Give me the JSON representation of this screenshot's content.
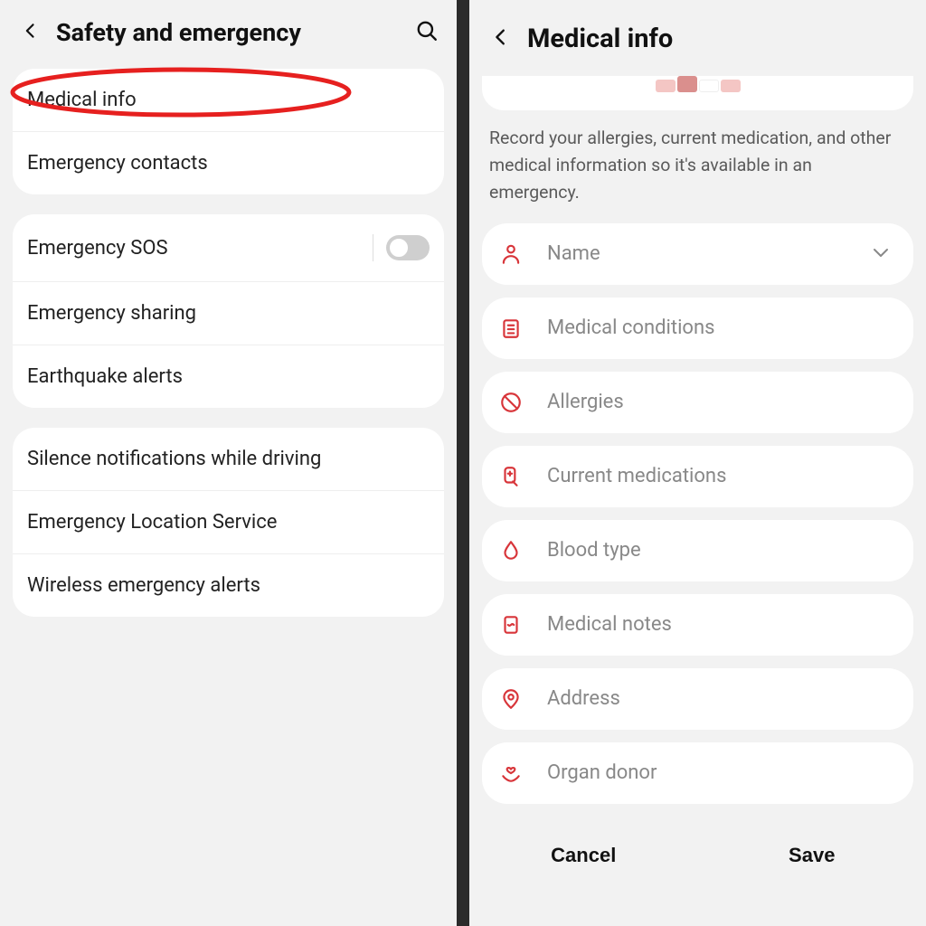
{
  "colors": {
    "accent": "#d8353a",
    "annotation": "#e6201f"
  },
  "left": {
    "title": "Safety and emergency",
    "group1": {
      "medical_info": "Medical info",
      "emergency_contacts": "Emergency contacts"
    },
    "group2": {
      "emergency_sos": "Emergency SOS",
      "emergency_sharing": "Emergency sharing",
      "earthquake_alerts": "Earthquake alerts"
    },
    "group3": {
      "silence_driving": "Silence notifications while driving",
      "location_service": "Emergency Location Service",
      "wireless_alerts": "Wireless emergency alerts"
    },
    "sos_toggle": false
  },
  "right": {
    "title": "Medical info",
    "description": "Record your allergies, current medication, and other medical information so it's available in an emergency.",
    "fields": {
      "name": "Name",
      "medical_conditions": "Medical conditions",
      "allergies": "Allergies",
      "current_medications": "Current medications",
      "blood_type": "Blood type",
      "medical_notes": "Medical notes",
      "address": "Address",
      "organ_donor": "Organ donor"
    },
    "actions": {
      "cancel": "Cancel",
      "save": "Save"
    },
    "avatar_colors": [
      "#f4c6c4",
      "#da8f8d",
      "#ffffff",
      "#f4c6c4"
    ]
  }
}
